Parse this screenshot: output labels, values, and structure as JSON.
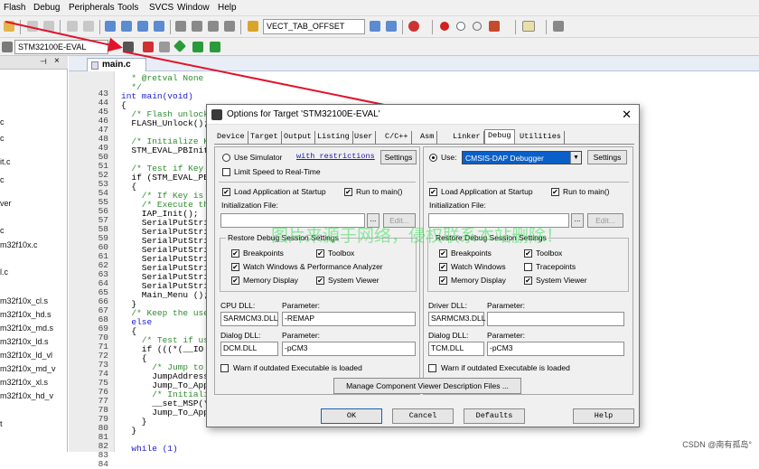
{
  "menubar": {
    "items": [
      "Flash",
      "Debug",
      "Peripherals",
      "Tools",
      "SVCS",
      "Window",
      "Help"
    ]
  },
  "toolbar1": {
    "target_combo": "VECT_TAB_OFFSET"
  },
  "toolbar2": {
    "project_combo": "STM32100E-EVAL"
  },
  "left_panel": {
    "items": [
      "c",
      "c",
      "it.c",
      "c",
      "ver",
      "c",
      "m32f10x.c",
      "l.c",
      "m32f10x_cl.s",
      "m32f10x_hd.s",
      "m32f10x_md.s",
      "m32f10x_ld.s",
      "m32f10x_ld_vl",
      "m32f10x_md_v",
      "m32f10x_xl.s",
      "m32f10x_hd_v",
      "t"
    ],
    "header_glyph": "×"
  },
  "editor": {
    "tab": "main.c",
    "lines": [
      {
        "n": "43",
        "t": "  * @retval None",
        "c": "cm"
      },
      {
        "n": "44",
        "t": "  */",
        "c": "cm"
      },
      {
        "n": "45",
        "t": "int main(void)",
        "c": "kw"
      },
      {
        "n": "46",
        "t": "{",
        "c": ""
      },
      {
        "n": "47",
        "t": "  /* Flash unlock",
        "c": "cm"
      },
      {
        "n": "48",
        "t": "  FLASH_Unlock();",
        "c": ""
      },
      {
        "n": "49",
        "t": "",
        "c": ""
      },
      {
        "n": "50",
        "t": "  /* Initialize Ke",
        "c": "cm"
      },
      {
        "n": "51",
        "t": "  STM_EVAL_PBInit(",
        "c": ""
      },
      {
        "n": "52",
        "t": "",
        "c": ""
      },
      {
        "n": "53",
        "t": "  /* Test if Key p",
        "c": "cm"
      },
      {
        "n": "54",
        "t": "  if (STM_EVAL_PBG",
        "c": ""
      },
      {
        "n": "55",
        "t": "  {",
        "c": ""
      },
      {
        "n": "56",
        "t": "    /* If Key is p",
        "c": "cm"
      },
      {
        "n": "57",
        "t": "    /* Execute the",
        "c": "cm"
      },
      {
        "n": "58",
        "t": "    IAP_Init();",
        "c": ""
      },
      {
        "n": "59",
        "t": "    SerialPutStrin",
        "c": ""
      },
      {
        "n": "60",
        "t": "    SerialPutStrin",
        "c": ""
      },
      {
        "n": "61",
        "t": "    SerialPutStrin",
        "c": ""
      },
      {
        "n": "62",
        "t": "    SerialPutStrin",
        "c": ""
      },
      {
        "n": "63",
        "t": "    SerialPutStrin",
        "c": ""
      },
      {
        "n": "64",
        "t": "    SerialPutStrin",
        "c": ""
      },
      {
        "n": "65",
        "t": "    SerialPutStrin",
        "c": ""
      },
      {
        "n": "66",
        "t": "    SerialPutStrin",
        "c": ""
      },
      {
        "n": "67",
        "t": "    Main_Menu ();",
        "c": ""
      },
      {
        "n": "68",
        "t": "  }",
        "c": ""
      },
      {
        "n": "69",
        "t": "  /* Keep the user",
        "c": "cm"
      },
      {
        "n": "70",
        "t": "  else",
        "c": "kw"
      },
      {
        "n": "71",
        "t": "  {",
        "c": ""
      },
      {
        "n": "72",
        "t": "    /* Test if use",
        "c": "cm"
      },
      {
        "n": "73",
        "t": "    if (((*(__IO v",
        "c": ""
      },
      {
        "n": "74",
        "t": "    {",
        "c": ""
      },
      {
        "n": "75",
        "t": "      /* Jump to u",
        "c": "cm"
      },
      {
        "n": "76",
        "t": "      JumpAddress",
        "c": ""
      },
      {
        "n": "77",
        "t": "      Jump_To_Appl",
        "c": ""
      },
      {
        "n": "78",
        "t": "      /* Initiali",
        "c": "cm"
      },
      {
        "n": "79",
        "t": "      __set_MSP(*",
        "c": ""
      },
      {
        "n": "80",
        "t": "      Jump_To_Appl",
        "c": ""
      },
      {
        "n": "81",
        "t": "    }",
        "c": ""
      },
      {
        "n": "82",
        "t": "  }",
        "c": ""
      },
      {
        "n": "83",
        "t": "",
        "c": ""
      },
      {
        "n": "84",
        "t": "  while (1)",
        "c": "kw"
      }
    ]
  },
  "dialog": {
    "title": "Options for Target 'STM32100E-EVAL'",
    "close": "✕",
    "tabs": [
      "Device",
      "Target",
      "Output",
      "Listing",
      "User",
      "C/C++",
      "Asm",
      "Linker",
      "Debug",
      "Utilities"
    ],
    "active_tab": "Debug",
    "left": {
      "use_simulator": "Use Simulator",
      "with_restrictions": "with restrictions",
      "settings": "Settings",
      "limit_speed": "Limit Speed to Real-Time",
      "load_app": "Load Application at Startup",
      "run_to_main": "Run to main()",
      "init_file_label": "Initialization File:",
      "browse": "...",
      "edit": "Edit...",
      "restore_title": "Restore Debug Session Settings",
      "breakpoints": "Breakpoints",
      "toolbox": "Toolbox",
      "watch": "Watch Windows & Performance Analyzer",
      "memory": "Memory Display",
      "system_viewer": "System Viewer",
      "cpu_dll_label": "CPU DLL:",
      "cpu_dll": "SARMCM3.DLL",
      "param_label": "Parameter:",
      "cpu_param": "-REMAP",
      "dialog_dll_label": "Dialog DLL:",
      "dialog_dll": "DCM.DLL",
      "dialog_param": "-pCM3",
      "warn": "Warn if outdated Executable is loaded"
    },
    "right": {
      "use": "Use:",
      "debugger": "CMSIS-DAP Debugger",
      "settings": "Settings",
      "load_app": "Load Application at Startup",
      "run_to_main": "Run to main()",
      "init_file_label": "Initialization File:",
      "browse": "...",
      "edit": "Edit...",
      "restore_title": "Restore Debug Session Settings",
      "breakpoints": "Breakpoints",
      "toolbox": "Toolbox",
      "watch": "Watch Windows",
      "tracepoints": "Tracepoints",
      "memory": "Memory Display",
      "system_viewer": "System Viewer",
      "driver_dll_label": "Driver DLL:",
      "driver_dll": "SARMCM3.DLL",
      "param_label": "Parameter:",
      "driver_param": "",
      "dialog_dll_label": "Dialog DLL:",
      "dialog_dll": "TCM.DLL",
      "dialog_param": "-pCM3",
      "warn": "Warn if outdated Executable is loaded"
    },
    "manage_button": "Manage Component Viewer Description Files ...",
    "buttons": {
      "ok": "OK",
      "cancel": "Cancel",
      "defaults": "Defaults",
      "help": "Help"
    }
  },
  "watermark": "图片来源于网络，侵权联系本站删除！",
  "credit": "CSDN @南有孤岛°",
  "checkmark": "✔",
  "colors": {
    "arrow": "#e0142c",
    "watermark": "#3cdc5a",
    "comment": "#2f8b2f",
    "keyword": "#1a1ad6"
  }
}
